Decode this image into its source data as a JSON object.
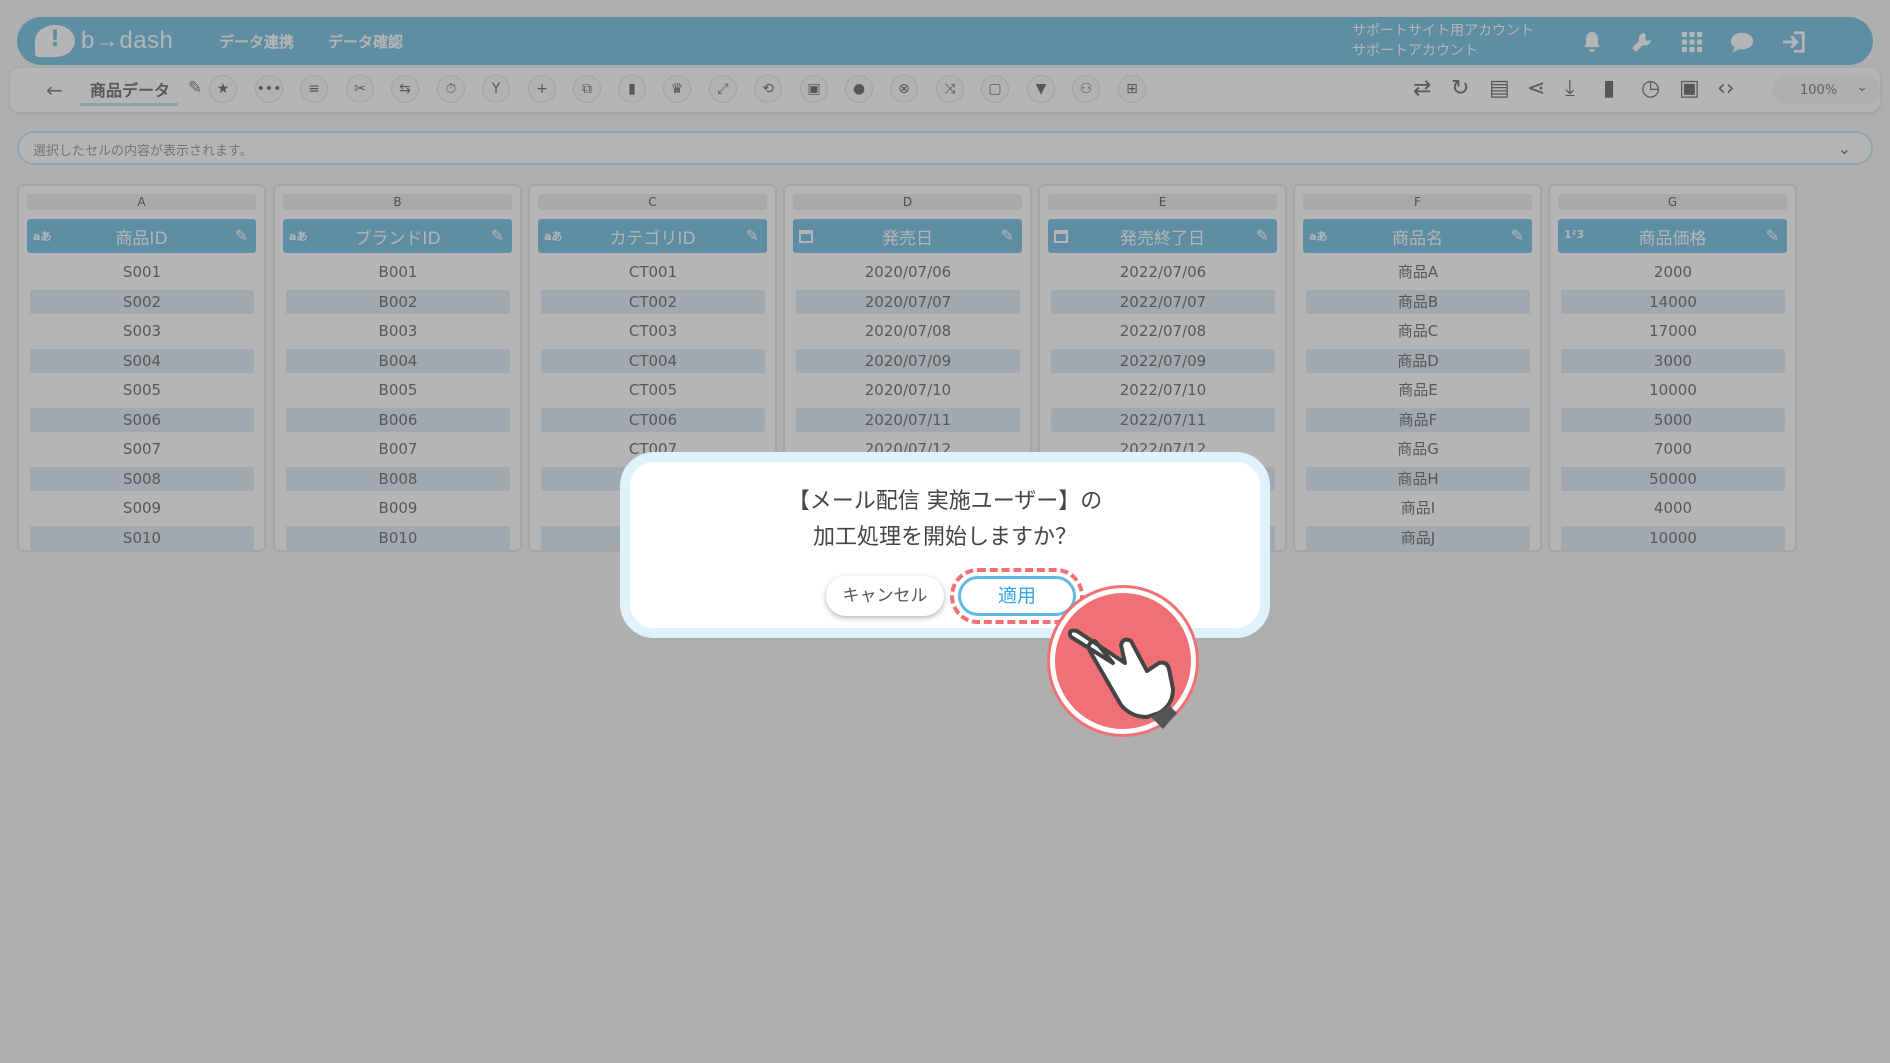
{
  "header": {
    "logo_text": "b→dash",
    "nav": [
      "データ連携",
      "データ確認"
    ],
    "account_line1": "サポートサイト用アカウント",
    "account_line2": "サポートアカウント"
  },
  "toolbar": {
    "data_name": "商品データ",
    "zoom": "100%"
  },
  "preview": {
    "placeholder": "選択したセルの内容が表示されます。"
  },
  "columns": [
    {
      "letter": "A",
      "title": "商品ID",
      "type": "aあ",
      "cells": [
        "S001",
        "S002",
        "S003",
        "S004",
        "S005",
        "S006",
        "S007",
        "S008",
        "S009",
        "S010"
      ]
    },
    {
      "letter": "B",
      "title": "ブランドID",
      "type": "aあ",
      "cells": [
        "B001",
        "B002",
        "B003",
        "B004",
        "B005",
        "B006",
        "B007",
        "B008",
        "B009",
        "B010"
      ]
    },
    {
      "letter": "C",
      "title": "カテゴリID",
      "type": "aあ",
      "cells": [
        "CT001",
        "CT002",
        "CT003",
        "CT004",
        "CT005",
        "CT006",
        "CT007",
        "",
        "",
        ""
      ]
    },
    {
      "letter": "D",
      "title": "発売日",
      "type": "calendar",
      "cells": [
        "2020/07/06",
        "2020/07/07",
        "2020/07/08",
        "2020/07/09",
        "2020/07/10",
        "2020/07/11",
        "2020/07/12",
        "",
        "",
        ""
      ]
    },
    {
      "letter": "E",
      "title": "発売終了日",
      "type": "calendar",
      "cells": [
        "2022/07/06",
        "2022/07/07",
        "2022/07/08",
        "2022/07/09",
        "2022/07/10",
        "2022/07/11",
        "2022/07/12",
        "",
        "",
        ""
      ]
    },
    {
      "letter": "F",
      "title": "商品名",
      "type": "aあ",
      "cells": [
        "商品A",
        "商品B",
        "商品C",
        "商品D",
        "商品E",
        "商品F",
        "商品G",
        "商品H",
        "商品I",
        "商品J"
      ]
    },
    {
      "letter": "G",
      "title": "商品価格",
      "type": "123",
      "cells": [
        "2000",
        "14000",
        "17000",
        "3000",
        "10000",
        "5000",
        "7000",
        "50000",
        "4000",
        "10000"
      ]
    }
  ],
  "modal": {
    "line1": "【メール配信 実施ユーザー】の",
    "line2": "加工処理を開始しますか？",
    "cancel_label": "キャンセル",
    "apply_label": "適用"
  }
}
